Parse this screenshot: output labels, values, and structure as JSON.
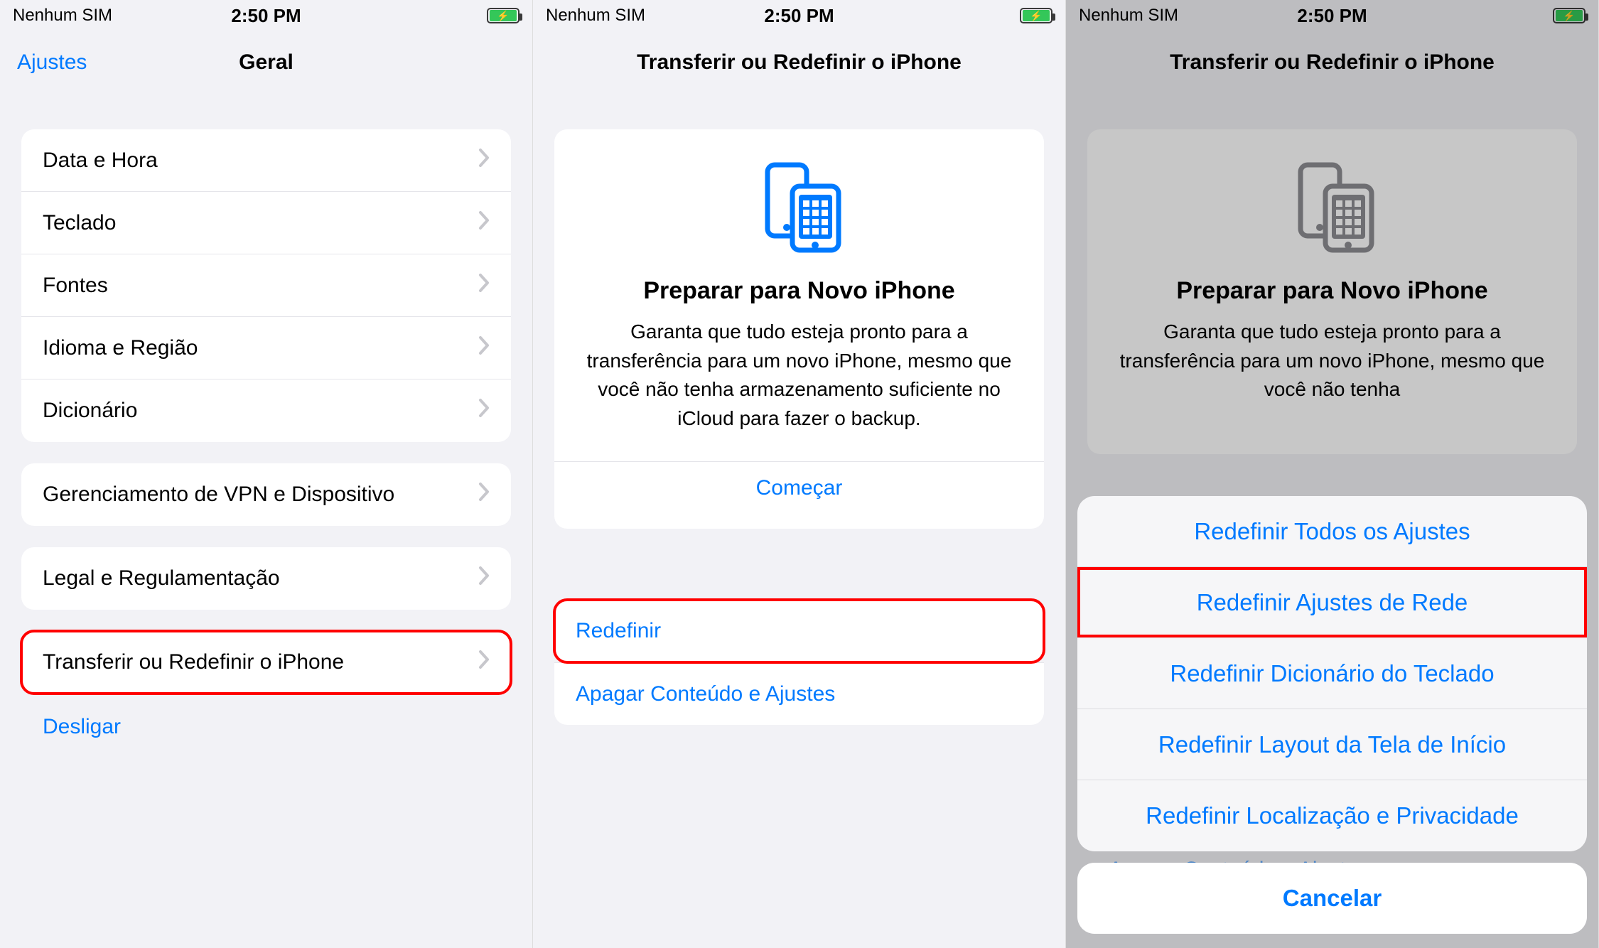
{
  "status": {
    "carrier": "Nenhum SIM",
    "time": "2:50 PM"
  },
  "screen1": {
    "back_label": "Ajustes",
    "title": "Geral",
    "group1": [
      "Data e Hora",
      "Teclado",
      "Fontes",
      "Idioma e Região",
      "Dicionário"
    ],
    "group2": [
      "Gerenciamento de VPN e Dispositivo"
    ],
    "group3": [
      "Legal e Regulamentação"
    ],
    "group4": [
      "Transferir ou Redefinir o iPhone"
    ],
    "shutdown": "Desligar"
  },
  "screen2": {
    "title": "Transferir ou Redefinir o iPhone",
    "card_title": "Preparar para Novo iPhone",
    "card_body": "Garanta que tudo esteja pronto para a transferência para um novo iPhone, mesmo que você não tenha armazenamento suficiente no iCloud para fazer o backup.",
    "card_action": "Começar",
    "rows": [
      "Redefinir",
      "Apagar Conteúdo e Ajustes"
    ]
  },
  "screen3": {
    "title": "Transferir ou Redefinir o iPhone",
    "card_title": "Preparar para Novo iPhone",
    "card_body": "Garanta que tudo esteja pronto para a transferência para um novo iPhone, mesmo que você não tenha",
    "sheet": [
      "Redefinir Todos os Ajustes",
      "Redefinir Ajustes de Rede",
      "Redefinir Dicionário do Teclado",
      "Redefinir Layout da Tela de Início",
      "Redefinir Localização e Privacidade"
    ],
    "cancel": "Cancelar",
    "bg_row": "Apagar Conteúdo e Ajustes"
  }
}
